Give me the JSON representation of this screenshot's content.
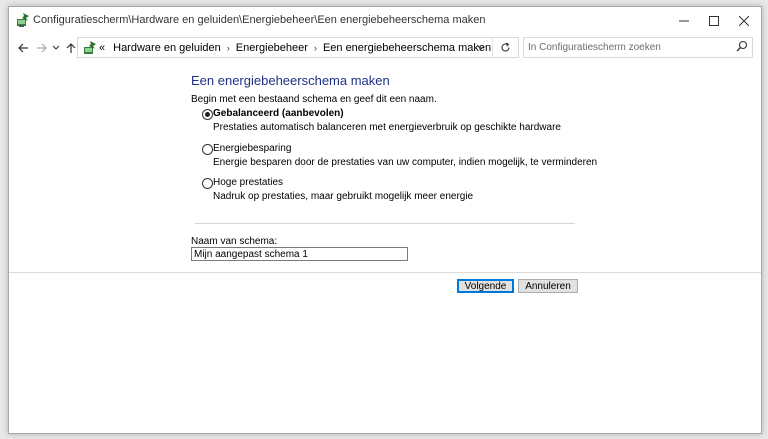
{
  "window": {
    "title": "Configuratiescherm\\Hardware en geluiden\\Energiebeheer\\Een energiebeheerschema maken"
  },
  "nav": {
    "overflow": "«",
    "breadcrumbs": [
      "Hardware en geluiden",
      "Energiebeheer",
      "Een energiebeheerschema maken"
    ],
    "search_placeholder": "In Configuratiescherm zoeken"
  },
  "main": {
    "title": "Een energiebeheerschema maken",
    "intro": "Begin met een bestaand schema en geef dit een naam.",
    "options": [
      {
        "label": "Gebalanceerd (aanbevolen)",
        "description": "Prestaties automatisch balanceren met energieverbruik op geschikte hardware",
        "selected": true
      },
      {
        "label": "Energiebesparing",
        "description": "Energie besparen door de prestaties van uw computer, indien mogelijk, te verminderen",
        "selected": false
      },
      {
        "label": "Hoge prestaties",
        "description": "Nadruk op prestaties, maar gebruikt mogelijk meer energie",
        "selected": false
      }
    ],
    "name_label": "Naam van schema:",
    "name_value": "Mijn aangepast schema 1"
  },
  "buttons": {
    "next": "Volgende",
    "cancel": "Annuleren"
  },
  "colors": {
    "title_blue": "#1e3287",
    "accent": "#0078d7"
  },
  "icons": {
    "app": "power-options-icon",
    "back": "arrow-left-icon",
    "forward": "arrow-right-icon",
    "recent": "chevron-down-icon",
    "up": "arrow-up-icon",
    "refresh": "refresh-icon",
    "search": "search-icon"
  }
}
